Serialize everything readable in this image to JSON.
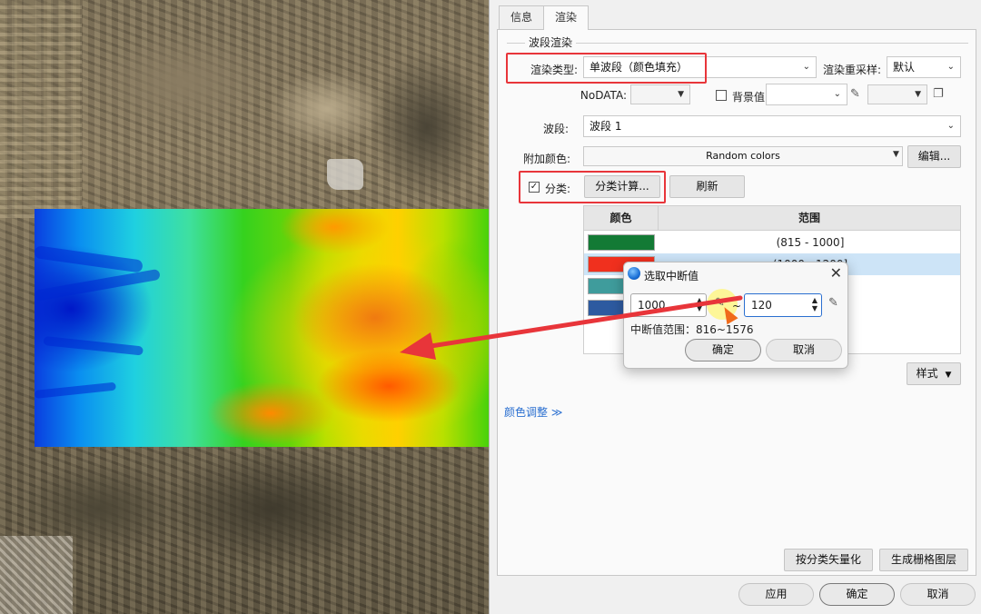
{
  "tabs": [
    {
      "label": "信息"
    },
    {
      "label": "渲染"
    }
  ],
  "band_render": {
    "group_title": "波段渲染",
    "render_type_label": "渲染类型:",
    "render_type_value": "单波段（颜色填充）",
    "resample_label": "渲染重采样:",
    "resample_value": "默认",
    "nodata_label": "NoDATA:",
    "background_label": "背景值",
    "band_label": "波段:",
    "band_value": "波段 1",
    "extra_color_label": "附加颜色:",
    "extra_color_value": "Random colors",
    "edit_button": "编辑...",
    "classify_label": "分类:",
    "classify_calc_button": "分类计算...",
    "refresh_button": "刷新",
    "style_button": "样式",
    "color_adjust_link": "颜色调整 ≫"
  },
  "table": {
    "headers": [
      "颜色",
      "范围"
    ],
    "rows": [
      {
        "color": "#137a35",
        "range": "(815 - 1000]"
      },
      {
        "color": "#f0301e",
        "range": "(1000 - 1200]"
      },
      {
        "color": "#3f9c9c",
        "range": ""
      },
      {
        "color": "#2d5aa0",
        "range": ""
      }
    ]
  },
  "modal": {
    "title": "选取中断值",
    "start_value": "1000",
    "step_value": "120",
    "separator": "~",
    "range_text": "中断值范围：816~1576",
    "ok_button": "确定",
    "cancel_button": "取消"
  },
  "bottom": {
    "vectorize_button": "按分类矢量化",
    "raster_button": "生成栅格图层",
    "apply_button": "应用",
    "ok_button": "确定",
    "cancel_button": "取消"
  },
  "icons": {
    "dropdown": "chevron-down-icon",
    "picker": "eyedropper-icon",
    "copy": "copy-icon",
    "close": "close-icon"
  },
  "colors": {
    "accent_red": "#e8353a",
    "selection": "#cde4f7",
    "link": "#2a6fd0"
  }
}
